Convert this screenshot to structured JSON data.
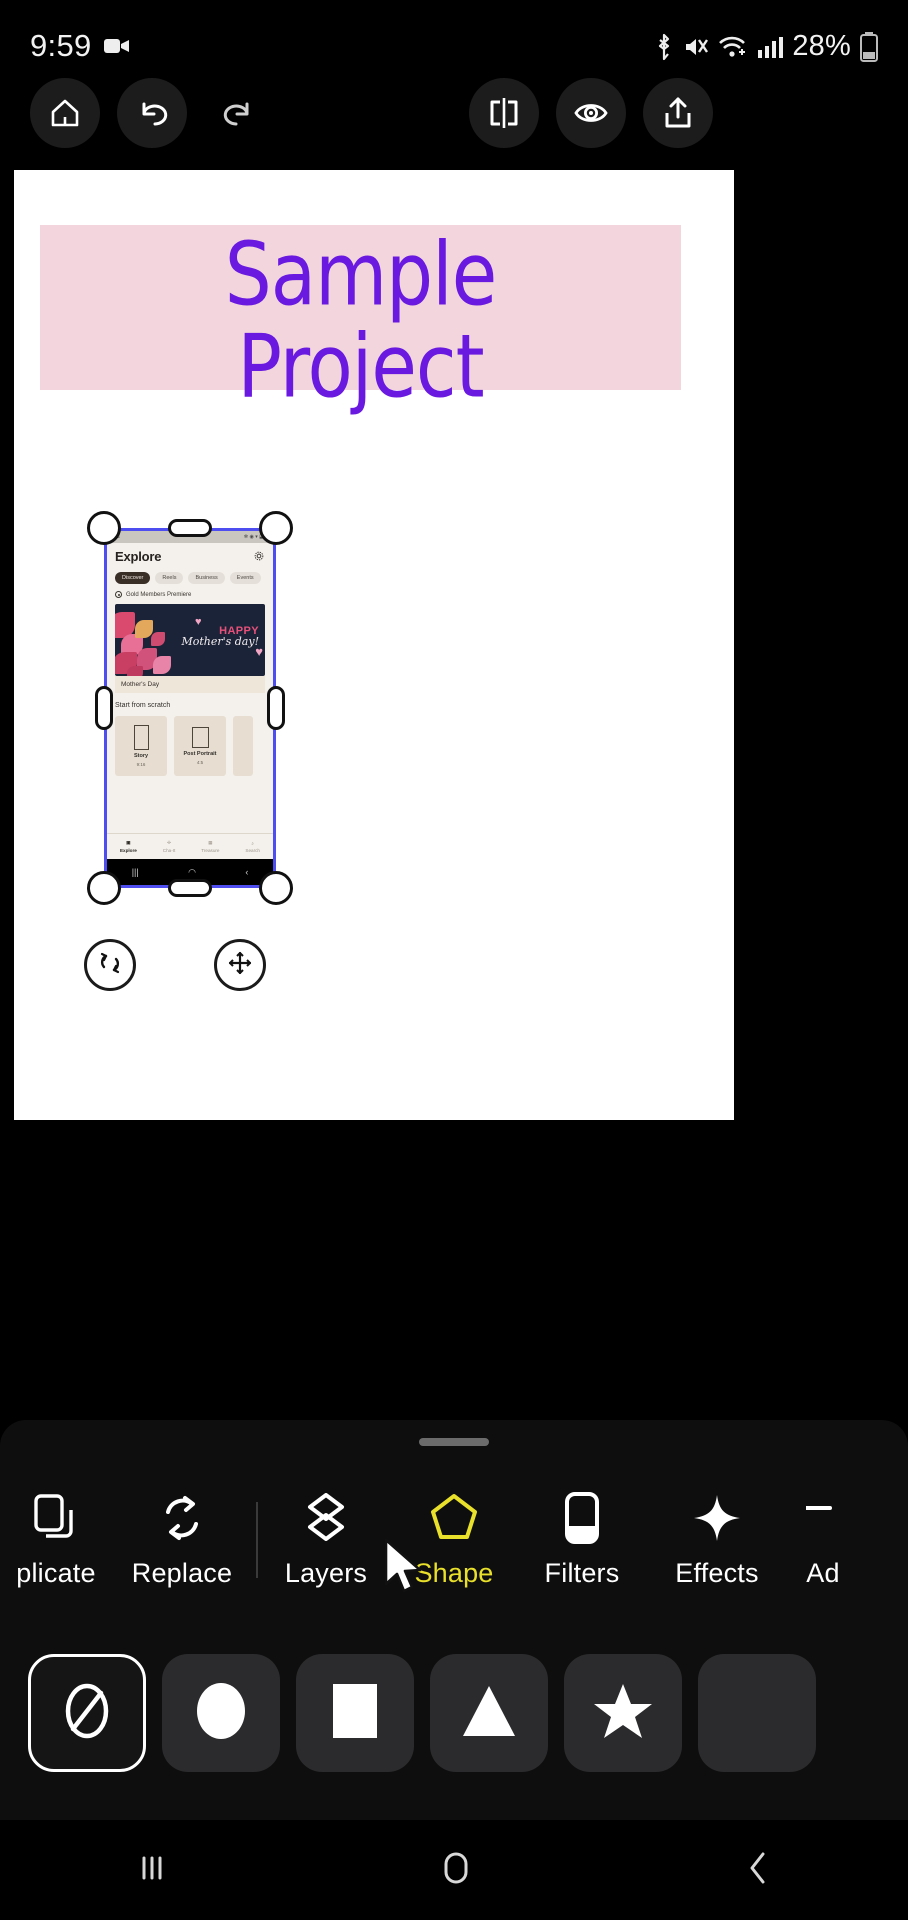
{
  "status_bar": {
    "clock": "9:59",
    "recording_icon": "video-recording-icon",
    "icons": [
      "bluetooth-icon",
      "mute-icon",
      "wifi-icon",
      "cellular-signal-icon"
    ],
    "battery_percent": "28%",
    "battery_icon": "battery-icon"
  },
  "toolbar": {
    "home": "home-icon",
    "undo": "undo-icon",
    "redo": "redo-icon",
    "compare": "compare-split-icon",
    "preview": "eye-preview-icon",
    "export": "share-export-icon"
  },
  "canvas": {
    "title_line1": "Sample",
    "title_line2": "Project",
    "title_color": "#6a1ae0",
    "title_band_color": "#f3d6dd",
    "background": "#ffffff"
  },
  "selection": {
    "frame_color": "#4d4df0",
    "handles": [
      "top-left",
      "top-right",
      "bottom-left",
      "bottom-right"
    ],
    "edge_pills": [
      "top",
      "bottom",
      "left",
      "right"
    ],
    "rotate_button": "rotate-icon",
    "move_button": "move-icon"
  },
  "thumbnail": {
    "heading": "Explore",
    "settings_icon": "gear-icon",
    "chips": [
      "Discover",
      "Reels",
      "Business",
      "Events"
    ],
    "active_chip": "Discover",
    "section_gold": "Gold Members Premiere",
    "banner": {
      "line1": "HAPPY",
      "line2": "Mother's day!"
    },
    "banner_caption": "Mother's Day",
    "section_scratch": "Start from scratch",
    "cards": [
      {
        "label": "Story",
        "ratio": "9:16"
      },
      {
        "label": "Post Portrait",
        "ratio": "4:5"
      }
    ],
    "nav": [
      {
        "label": "Explore",
        "icon": "explore-icon",
        "active": true
      },
      {
        "label": "Cha-It",
        "icon": "magic-icon",
        "active": false
      },
      {
        "label": "Treasure",
        "icon": "grid-icon",
        "active": false
      },
      {
        "label": "Search",
        "icon": "search-icon",
        "active": false
      }
    ]
  },
  "bottom_sheet": {
    "tools": [
      {
        "label": "plicate",
        "icon": "duplicate-icon",
        "active": false
      },
      {
        "label": "Replace",
        "icon": "replace-icon",
        "active": false
      },
      {
        "label": "Layers",
        "icon": "layers-icon",
        "active": false
      },
      {
        "label": "Shape",
        "icon": "pentagon-shape-icon",
        "active": true
      },
      {
        "label": "Filters",
        "icon": "filters-icon",
        "active": false
      },
      {
        "label": "Effects",
        "icon": "effects-sparkle-icon",
        "active": false
      },
      {
        "label": "Ad",
        "icon": "adjust-icon",
        "active": false
      }
    ],
    "active_tool": "Shape",
    "active_color": "#e8e02a",
    "shapes": [
      {
        "name": "none-shape",
        "selected": true
      },
      {
        "name": "circle-shape",
        "selected": false
      },
      {
        "name": "square-shape",
        "selected": false
      },
      {
        "name": "triangle-shape",
        "selected": false
      },
      {
        "name": "star-shape",
        "selected": false
      },
      {
        "name": "hexagon-shape",
        "selected": false
      }
    ]
  },
  "android_nav": {
    "recents": "recents-icon",
    "home": "home-pill-icon",
    "back": "back-chevron-icon"
  }
}
